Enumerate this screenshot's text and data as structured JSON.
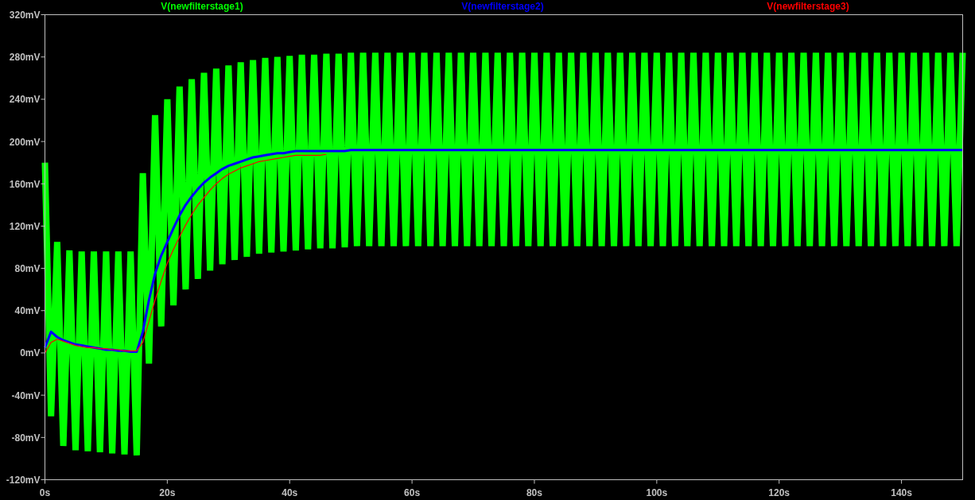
{
  "chart_data": {
    "type": "line",
    "x": [
      0,
      1,
      2,
      3,
      4,
      5,
      6,
      7,
      8,
      9,
      10,
      11,
      12,
      13,
      14,
      15,
      16,
      17,
      18,
      19,
      20,
      21,
      22,
      23,
      24,
      25,
      26,
      27,
      28,
      29,
      30,
      31,
      32,
      33,
      34,
      35,
      36,
      37,
      38,
      39,
      40,
      41,
      42,
      43,
      44,
      45,
      46,
      47,
      48,
      49,
      50,
      51,
      52,
      53,
      54,
      55,
      56,
      57,
      58,
      59,
      60,
      61,
      62,
      63,
      64,
      65,
      66,
      67,
      68,
      69,
      70,
      71,
      72,
      73,
      74,
      75,
      76,
      77,
      78,
      79,
      80,
      81,
      82,
      83,
      84,
      85,
      86,
      87,
      88,
      89,
      90,
      91,
      92,
      93,
      94,
      95,
      96,
      97,
      98,
      99,
      100,
      101,
      102,
      103,
      104,
      105,
      106,
      107,
      108,
      109,
      110,
      111,
      112,
      113,
      114,
      115,
      116,
      117,
      118,
      119,
      120,
      121,
      122,
      123,
      124,
      125,
      126,
      127,
      128,
      129,
      130,
      131,
      132,
      133,
      134,
      135,
      136,
      137,
      138,
      139,
      140,
      141,
      142,
      143,
      144,
      145,
      146,
      147,
      148,
      149,
      150
    ],
    "series": [
      {
        "name": "V(newfilterstage1)",
        "color": "#00ff00",
        "values": [
          180,
          -60,
          105,
          -88,
          97,
          -92,
          96,
          -93,
          96,
          -94,
          96,
          -95,
          96,
          -96,
          96,
          -97,
          170,
          -10,
          225,
          25,
          240,
          45,
          252,
          60,
          259,
          70,
          265,
          78,
          269,
          84,
          272,
          88,
          275,
          91,
          277,
          94,
          279,
          95,
          280,
          96,
          281,
          97,
          282,
          98,
          282,
          99,
          283,
          99,
          283,
          100,
          284,
          101,
          284,
          101,
          284,
          101,
          284,
          101,
          284,
          101,
          284,
          101,
          284,
          101,
          284,
          101,
          284,
          101,
          284,
          101,
          284,
          101,
          284,
          101,
          284,
          101,
          284,
          101,
          284,
          101,
          284,
          101,
          284,
          101,
          284,
          101,
          284,
          101,
          284,
          101,
          284,
          101,
          284,
          101,
          284,
          101,
          284,
          101,
          284,
          101,
          284,
          101,
          284,
          101,
          284,
          101,
          284,
          101,
          284,
          101,
          284,
          101,
          284,
          101,
          284,
          101,
          284,
          101,
          284,
          101,
          284,
          101,
          284,
          101,
          284,
          101,
          284,
          101,
          284,
          101,
          284,
          101,
          284,
          101,
          284,
          101,
          284,
          101,
          284,
          101,
          284,
          101,
          284,
          101,
          284,
          101,
          284,
          101,
          284,
          101,
          284
        ]
      },
      {
        "name": "V(newfilterstage2)",
        "color": "#0000ff",
        "values": [
          5,
          20,
          15,
          12,
          10,
          8,
          7,
          6,
          5,
          4,
          3,
          3,
          2,
          2,
          1,
          1,
          20,
          50,
          75,
          92,
          105,
          118,
          130,
          140,
          148,
          155,
          161,
          166,
          170,
          174,
          177,
          179,
          181,
          183,
          185,
          186,
          187,
          188,
          189,
          189,
          190,
          191,
          191,
          191,
          191,
          191,
          191,
          191,
          191,
          191,
          192,
          192,
          192,
          192,
          192,
          192,
          192,
          192,
          192,
          192,
          192,
          192,
          192,
          192,
          192,
          192,
          192,
          192,
          192,
          192,
          192,
          192,
          192,
          192,
          192,
          192,
          192,
          192,
          192,
          192,
          192,
          192,
          192,
          192,
          192,
          192,
          192,
          192,
          192,
          192,
          192,
          192,
          192,
          192,
          192,
          192,
          192,
          192,
          192,
          192,
          192,
          192,
          192,
          192,
          192,
          192,
          192,
          192,
          192,
          192,
          192,
          192,
          192,
          192,
          192,
          192,
          192,
          192,
          192,
          192,
          192,
          192,
          192,
          192,
          192,
          192,
          192,
          192,
          192,
          192,
          192,
          192,
          192,
          192,
          192,
          192,
          192,
          192,
          192,
          192,
          192,
          192,
          192,
          192,
          192,
          192,
          192,
          192,
          192,
          192,
          192
        ]
      },
      {
        "name": "V(newfilterstage3)",
        "color": "#ff0000",
        "values": [
          0,
          10,
          13,
          11,
          9,
          7,
          6,
          5,
          5,
          4,
          4,
          3,
          3,
          2,
          2,
          2,
          10,
          30,
          50,
          68,
          85,
          98,
          110,
          121,
          131,
          140,
          147,
          154,
          160,
          165,
          169,
          172,
          175,
          177,
          179,
          181,
          182,
          183,
          184,
          185,
          186,
          187,
          187,
          187,
          187,
          187,
          188,
          null,
          null,
          null,
          null,
          null,
          null,
          null,
          null,
          null,
          null,
          null,
          null,
          null,
          null,
          null,
          null,
          null,
          null,
          null,
          null,
          null,
          null,
          null,
          null,
          null,
          null,
          null,
          null,
          null,
          null,
          null,
          null,
          null,
          null,
          null,
          null,
          null,
          null,
          null,
          null,
          null,
          null,
          null,
          null,
          null,
          null,
          null,
          null,
          null,
          null,
          null,
          null,
          null,
          null,
          null,
          null,
          null,
          null,
          null,
          null,
          null,
          null,
          null,
          null,
          null,
          null,
          null,
          null,
          null,
          null,
          null,
          null,
          null,
          null,
          null,
          null,
          null,
          null,
          null,
          null,
          null,
          null,
          null,
          null,
          null,
          null,
          null,
          null,
          null,
          null,
          null,
          null,
          null,
          null,
          null,
          null,
          null,
          null,
          null,
          null,
          null,
          null,
          null,
          null
        ]
      }
    ],
    "xlim": [
      0,
      150
    ],
    "ylim": [
      -120,
      320
    ],
    "xticks": [
      {
        "value": 0,
        "label": "0s"
      },
      {
        "value": 20,
        "label": "20s"
      },
      {
        "value": 40,
        "label": "40s"
      },
      {
        "value": 60,
        "label": "60s"
      },
      {
        "value": 80,
        "label": "80s"
      },
      {
        "value": 100,
        "label": "100s"
      },
      {
        "value": 120,
        "label": "120s"
      },
      {
        "value": 140,
        "label": "140s"
      }
    ],
    "yticks": [
      {
        "value": -120,
        "label": "-120mV"
      },
      {
        "value": -80,
        "label": "-80mV"
      },
      {
        "value": -40,
        "label": "-40mV"
      },
      {
        "value": 0,
        "label": "0mV"
      },
      {
        "value": 40,
        "label": "40mV"
      },
      {
        "value": 80,
        "label": "80mV"
      },
      {
        "value": 120,
        "label": "120mV"
      },
      {
        "value": 160,
        "label": "160mV"
      },
      {
        "value": 200,
        "label": "200mV"
      },
      {
        "value": 240,
        "label": "240mV"
      },
      {
        "value": 280,
        "label": "280mV"
      },
      {
        "value": 320,
        "label": "320mV"
      }
    ]
  }
}
